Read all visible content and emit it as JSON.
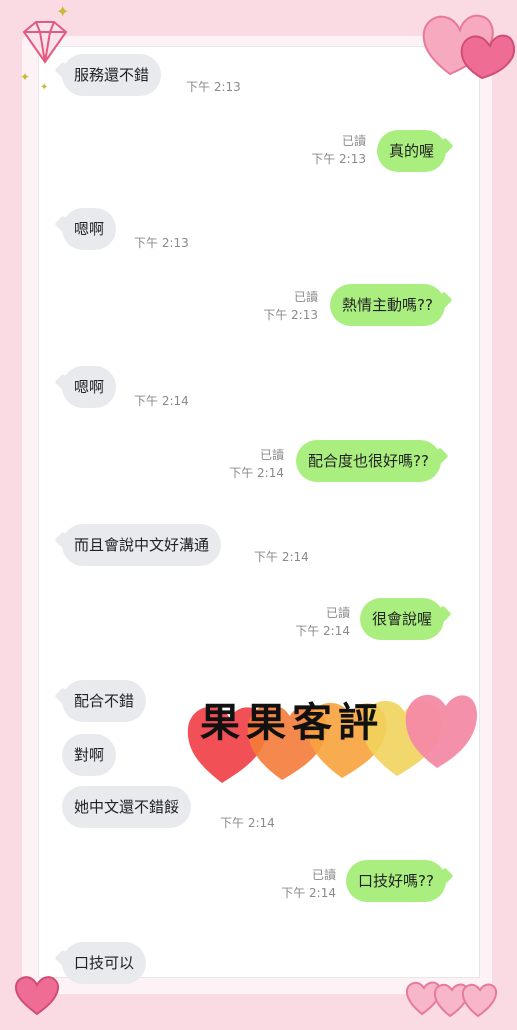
{
  "messages": [
    {
      "side": "left",
      "text": "服務還不錯",
      "time": "下午 2:13"
    },
    {
      "side": "right",
      "text": "真的喔",
      "read": "已讀",
      "time": "下午 2:13"
    },
    {
      "side": "left",
      "text": "嗯啊",
      "time": "下午 2:13"
    },
    {
      "side": "right",
      "text": "熱情主動嗎??",
      "read": "已讀",
      "time": "下午 2:13"
    },
    {
      "side": "left",
      "text": "嗯啊",
      "time": "下午 2:14"
    },
    {
      "side": "right",
      "text": "配合度也很好嗎??",
      "read": "已讀",
      "time": "下午 2:14"
    },
    {
      "side": "left",
      "text": "而且會說中文好溝通",
      "time": "下午 2:14"
    },
    {
      "side": "right",
      "text": "很會說喔",
      "read": "已讀",
      "time": "下午 2:14"
    },
    {
      "side": "left",
      "text": "配合不錯"
    },
    {
      "side": "left",
      "text": "對啊"
    },
    {
      "side": "left",
      "text": "她中文還不錯餒",
      "time": "下午 2:14"
    },
    {
      "side": "right",
      "text": "口技好嗎??",
      "read": "已讀",
      "time": "下午 2:14"
    },
    {
      "side": "left",
      "text": "口技可以"
    }
  ],
  "stamp": {
    "text": "果果客評"
  },
  "colors": {
    "left_bubble": "#e9eaee",
    "right_bubble": "#aaee80",
    "background": "#fadbe4"
  },
  "decorations": [
    "diamond-icon",
    "heart-icon",
    "sparkle-icon"
  ]
}
